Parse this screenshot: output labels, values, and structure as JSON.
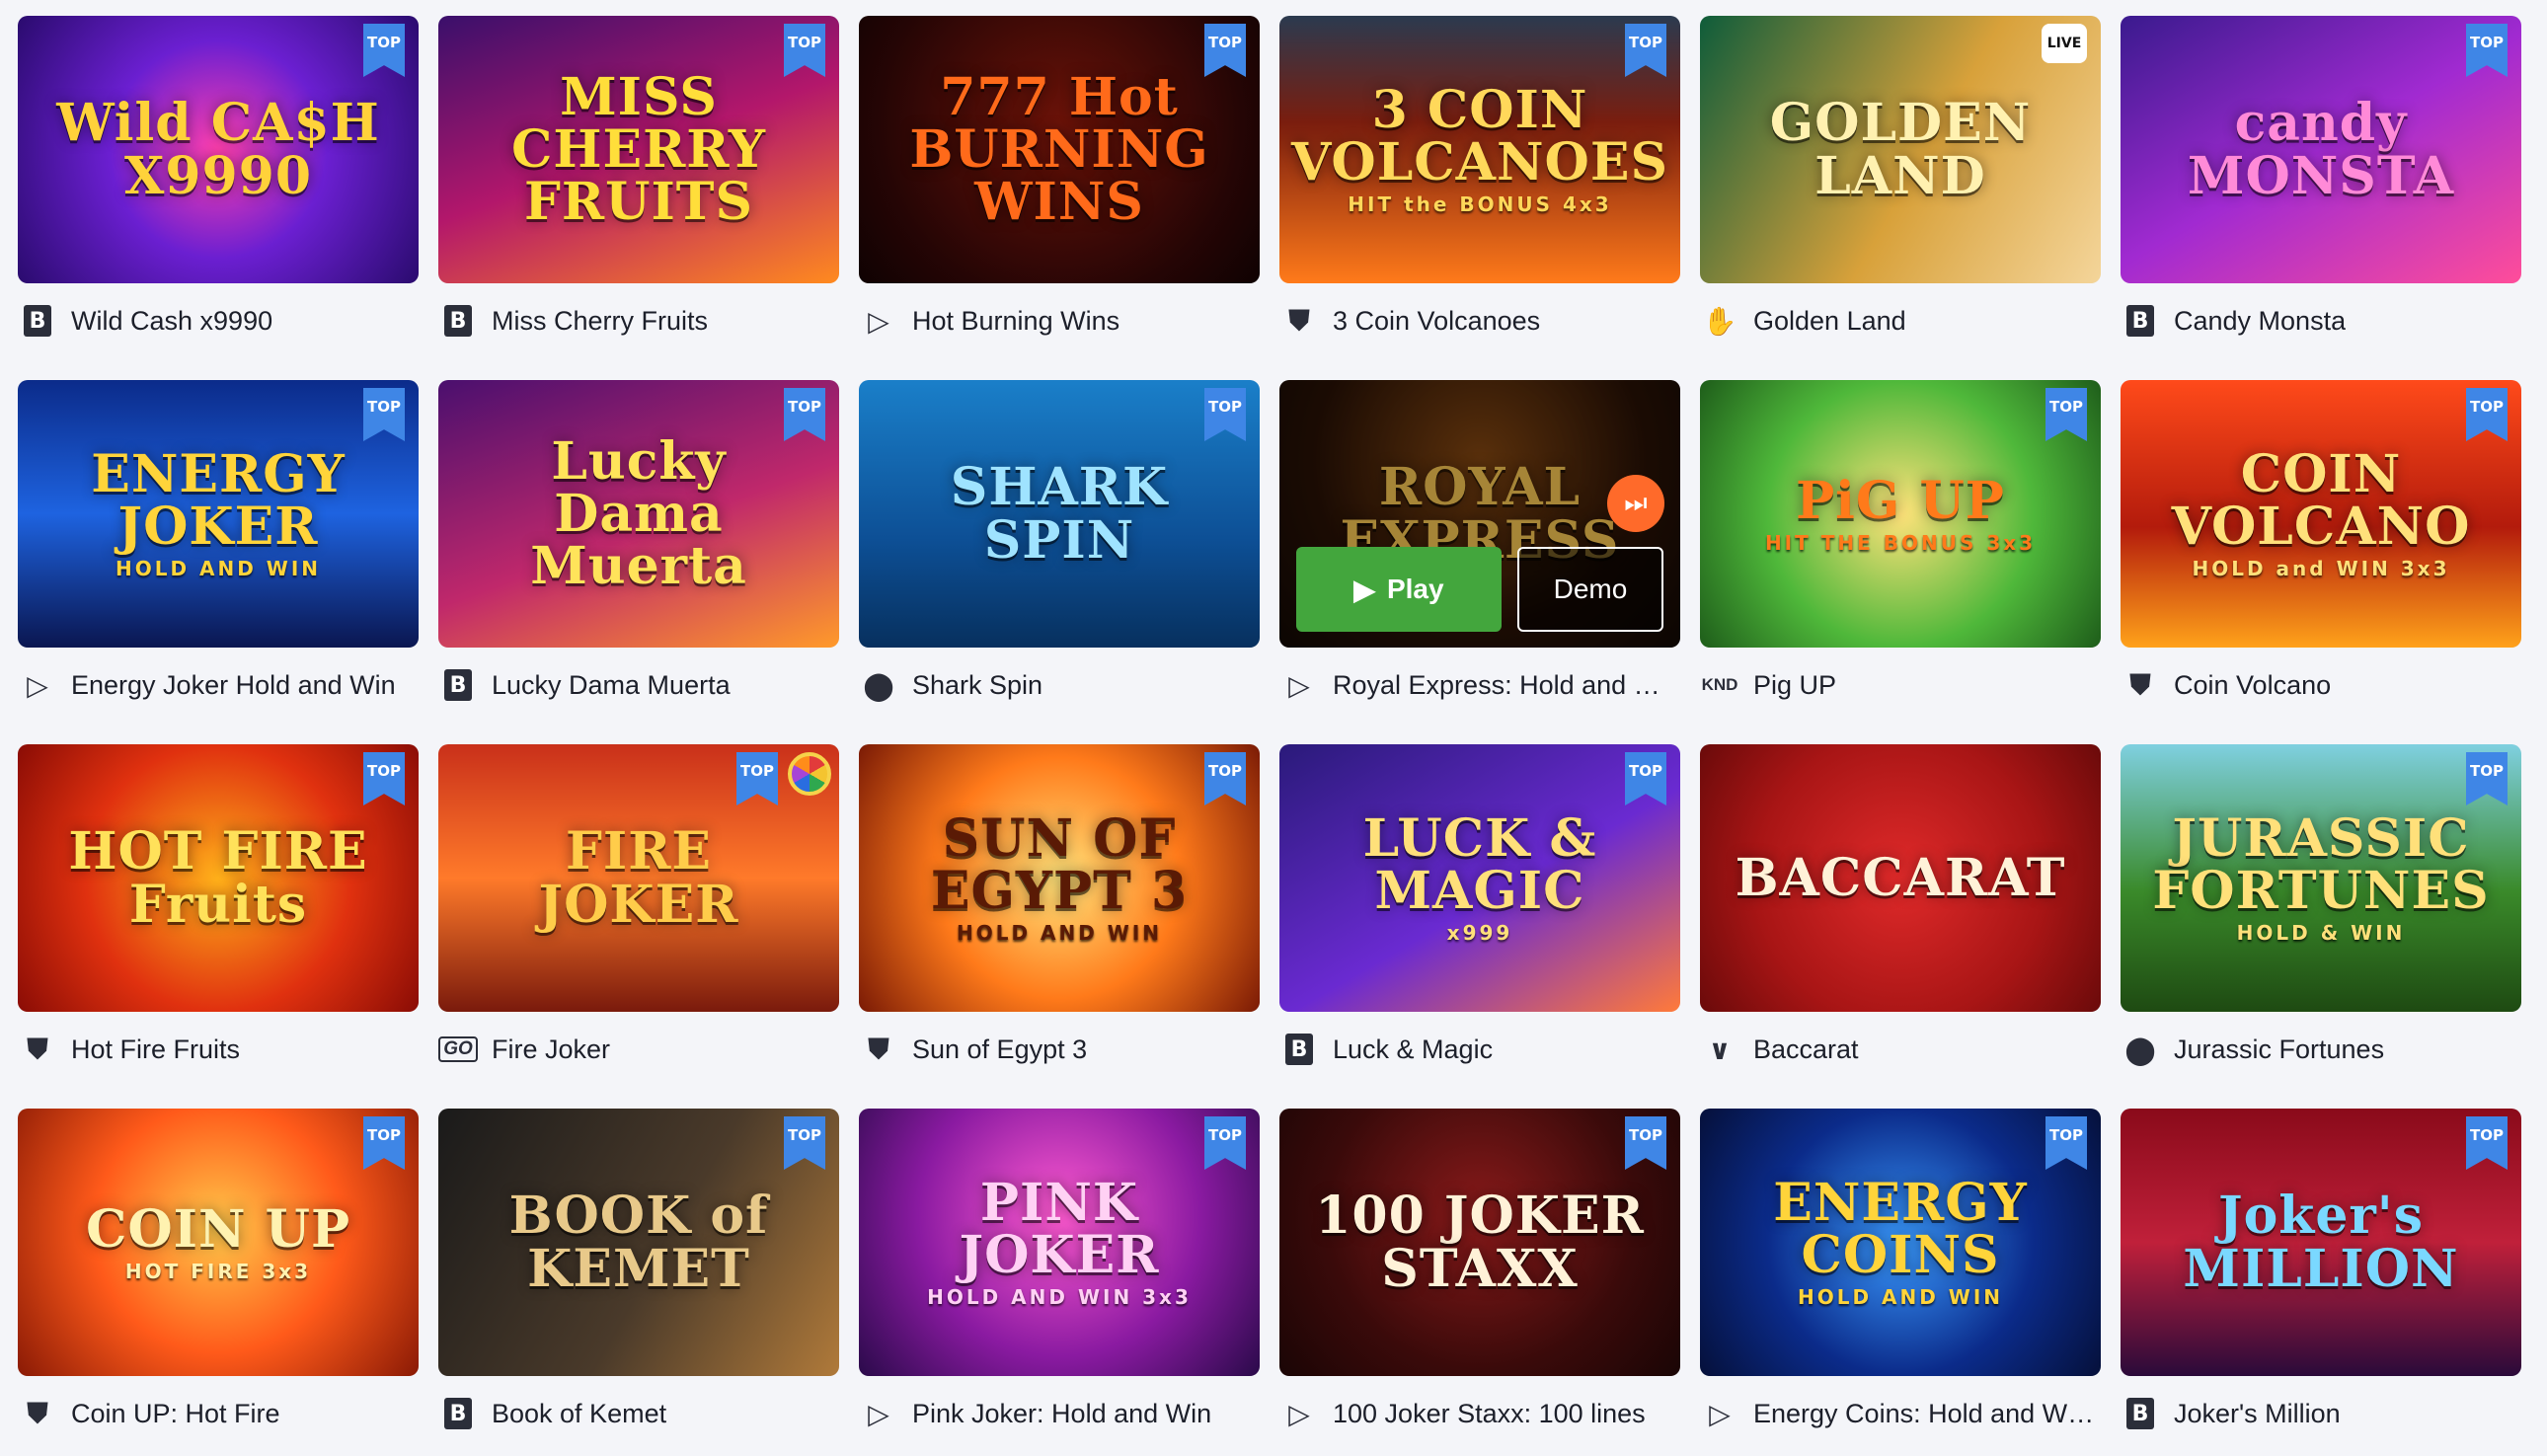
{
  "colors": {
    "background": "#f4f5f9",
    "top_badge": "#3f86e6",
    "play_button": "#43a63d",
    "title_text": "#1c1f2a"
  },
  "badges": {
    "top": "TOP",
    "live": "LIVE"
  },
  "hover": {
    "play_label": "Play",
    "demo_label": "Demo"
  },
  "games": [
    {
      "title": "Wild Cash x9990",
      "provider_icon": "b-letter-icon",
      "provider_glyph": "B",
      "badge": "top",
      "art_text": "Wild CA$H X9990",
      "art_sub": "",
      "bg": "radial-gradient(circle at 50% 50%, #ff3fae 0, #6b1fd1 45%, #2a0b6e 100%)",
      "text_color": "#ffd23a"
    },
    {
      "title": "Miss Cherry Fruits",
      "provider_icon": "b-letter-icon",
      "provider_glyph": "B",
      "badge": "top",
      "art_text": "MISS CHERRY FRUITS",
      "art_sub": "",
      "bg": "linear-gradient(160deg, #3a0f6b 0%, #b3176b 50%, #ff8a1f 100%)",
      "text_color": "#ffde3a"
    },
    {
      "title": "Hot Burning Wins",
      "provider_icon": "play-triangle-icon",
      "provider_glyph": "▷",
      "badge": "top",
      "art_text": "777 Hot BURNING WINS",
      "art_sub": "",
      "bg": "radial-gradient(circle at 50% 40%, #6a1208 0, #250505 70%, #0f0202 100%)",
      "text_color": "#ff6a1a"
    },
    {
      "title": "3 Coin Volcanoes",
      "provider_icon": "shield-icon",
      "provider_glyph": "⛊",
      "badge": "top",
      "art_text": "3 COIN VOLCANOES",
      "art_sub": "HIT the BONUS 4x3",
      "bg": "linear-gradient(180deg, #2b3a4f 0%, #7a1d0e 40%, #ff7a1a 100%)",
      "text_color": "#ffd85a"
    },
    {
      "title": "Golden Land",
      "provider_icon": "hand-icon",
      "provider_glyph": "✋",
      "badge": "live",
      "art_text": "GOLDEN LAND",
      "art_sub": "",
      "bg": "linear-gradient(120deg, #0e5c3a 0%, #d8a13a 55%, #f4d59a 100%)",
      "text_color": "#fff1b0"
    },
    {
      "title": "Candy Monsta",
      "provider_icon": "b-letter-icon",
      "provider_glyph": "B",
      "badge": "top",
      "art_text": "candy MONSTA",
      "art_sub": "",
      "bg": "linear-gradient(150deg, #3a1a8e 0%, #a12ad1 50%, #ff4d9a 100%)",
      "text_color": "#ff8ad8"
    },
    {
      "title": "Energy Joker Hold and Win",
      "provider_icon": "play-triangle-icon",
      "provider_glyph": "▷",
      "badge": "top",
      "art_text": "ENERGY JOKER",
      "art_sub": "HOLD AND WIN",
      "bg": "linear-gradient(180deg, #0b2b8a 0%, #1e63e0 50%, #0a1650 100%)",
      "text_color": "#ffd43a"
    },
    {
      "title": "Lucky Dama Muerta",
      "provider_icon": "b-letter-icon",
      "provider_glyph": "B",
      "badge": "top",
      "art_text": "Lucky Dama Muerta",
      "art_sub": "",
      "bg": "linear-gradient(160deg, #4a0f6e 0%, #c0286b 55%, #ff9a2a 100%)",
      "text_color": "#ffe35a"
    },
    {
      "title": "Shark Spin",
      "provider_icon": "location-pin-icon",
      "provider_glyph": "⬤",
      "badge": "top",
      "art_text": "SHARK SPIN",
      "art_sub": "",
      "bg": "linear-gradient(180deg, #1a7fc9 0%, #0d4f95 60%, #07305e 100%)",
      "text_color": "#9fe3ff"
    },
    {
      "title": "Royal Express: Hold and …",
      "provider_icon": "play-triangle-icon",
      "provider_glyph": "▷",
      "badge": "",
      "art_text": "ROYAL EXPRESS",
      "art_sub": "",
      "bg": "radial-gradient(circle at 50% 30%, #8a4a12 0, #2a1206 60%, #120904 100%)",
      "text_color": "#ffcc55",
      "hovered": true
    },
    {
      "title": "Pig UP",
      "provider_icon": "knd-text-icon",
      "provider_glyph": "KND",
      "badge": "top",
      "art_text": "PiG UP",
      "art_sub": "HIT THE BONUS 3x3",
      "bg": "radial-gradient(circle at 50% 50%, #ffe27a 0, #4fb83a 55%, #1e5d1a 100%)",
      "text_color": "#ff7a1a"
    },
    {
      "title": "Coin Volcano",
      "provider_icon": "shield-icon",
      "provider_glyph": "⛊",
      "badge": "top",
      "art_text": "COIN VOLCANO",
      "art_sub": "HOLD and WIN 3x3",
      "bg": "linear-gradient(180deg, #ff4a1a 0%, #b31b0c 55%, #ffa21a 100%)",
      "text_color": "#ffe07a"
    },
    {
      "title": "Hot Fire Fruits",
      "provider_icon": "shield-icon",
      "provider_glyph": "⛊",
      "badge": "top",
      "art_text": "HOT FIRE Fruits",
      "art_sub": "",
      "bg": "radial-gradient(circle at 50% 50%, #ffb01a 0, #e0310f 55%, #8a0c05 100%)",
      "text_color": "#ffe15a"
    },
    {
      "title": "Fire Joker",
      "provider_icon": "go-text-icon",
      "provider_glyph": "GO",
      "badge": "top",
      "wheel": true,
      "art_text": "FIRE JOKER",
      "art_sub": "",
      "bg": "linear-gradient(180deg, #c9301a 0%, #ff7a2a 50%, #7a1a0c 100%)",
      "text_color": "#ffcc4a"
    },
    {
      "title": "Sun of Egypt 3",
      "provider_icon": "shield-icon",
      "provider_glyph": "⛊",
      "badge": "top",
      "art_text": "SUN OF EGYPT 3",
      "art_sub": "HOLD AND WIN",
      "bg": "radial-gradient(circle at 50% 50%, #ffe27a 0, #ff7a1a 50%, #7a1a05 100%)",
      "text_color": "#5a1a05"
    },
    {
      "title": "Luck & Magic",
      "provider_icon": "b-letter-icon",
      "provider_glyph": "B",
      "badge": "top",
      "art_text": "LUCK & MAGIC",
      "art_sub": "x999",
      "bg": "linear-gradient(150deg, #2a1a7a 0%, #6a2ad1 55%, #ff7a3a 100%)",
      "text_color": "#ffe07a"
    },
    {
      "title": "Baccarat",
      "provider_icon": "v-check-icon",
      "provider_glyph": "∨",
      "badge": "",
      "art_text": "BACCARAT",
      "art_sub": "",
      "bg": "radial-gradient(circle at 50% 50%, #e02a2a 0, #a81515 60%, #6a0a0a 100%)",
      "text_color": "#fff2d8"
    },
    {
      "title": "Jurassic Fortunes",
      "provider_icon": "location-pin-icon",
      "provider_glyph": "⬤",
      "badge": "top",
      "art_text": "JURASSIC FORTUNES",
      "art_sub": "HOLD & WIN",
      "bg": "linear-gradient(180deg, #7fd0e0 0%, #3a8a2a 55%, #1e4a12 100%)",
      "text_color": "#ffe07a"
    },
    {
      "title": "Coin UP: Hot Fire",
      "provider_icon": "shield-icon",
      "provider_glyph": "⛊",
      "badge": "top",
      "art_text": "COIN UP",
      "art_sub": "HOT FIRE 3x3",
      "bg": "radial-gradient(circle at 50% 45%, #ffc84a 0, #ff5a1a 50%, #8a1a05 100%)",
      "text_color": "#fff2b0"
    },
    {
      "title": "Book of Kemet",
      "provider_icon": "b-letter-icon",
      "provider_glyph": "B",
      "badge": "top",
      "art_text": "BOOK of KEMET",
      "art_sub": "",
      "bg": "linear-gradient(120deg, #1a1a1a 0%, #4a3a2a 55%, #b07a3a 100%)",
      "text_color": "#e8c98a"
    },
    {
      "title": "Pink Joker: Hold and Win",
      "provider_icon": "play-triangle-icon",
      "provider_glyph": "▷",
      "badge": "top",
      "art_text": "PINK JOKER",
      "art_sub": "HOLD AND WIN 3x3",
      "bg": "radial-gradient(circle at 50% 40%, #ff5ad1 0, #8a1aa1 55%, #2a0a4a 100%)",
      "text_color": "#ffd1f4"
    },
    {
      "title": "100 Joker Staxx: 100 lines",
      "provider_icon": "play-triangle-icon",
      "provider_glyph": "▷",
      "badge": "top",
      "art_text": "100 JOKER STAXX",
      "art_sub": "",
      "bg": "radial-gradient(circle at 50% 40%, #8a1a1a 0, #3a0a0a 60%, #1a0505 100%)",
      "text_color": "#fff2d8"
    },
    {
      "title": "Energy Coins: Hold and W…",
      "provider_icon": "play-triangle-icon",
      "provider_glyph": "▷",
      "badge": "top",
      "art_text": "ENERGY COINS",
      "art_sub": "HOLD AND WIN",
      "bg": "radial-gradient(circle at 50% 50%, #3a9aff 0, #0b2b8a 55%, #05103a 100%)",
      "text_color": "#ffd43a"
    },
    {
      "title": "Joker's Million",
      "provider_icon": "b-letter-icon",
      "provider_glyph": "B",
      "badge": "top",
      "art_text": "Joker's MILLION",
      "art_sub": "",
      "bg": "linear-gradient(180deg, #8a0a1a 0%, #c0203a 50%, #2a0a3a 100%)",
      "text_color": "#7ad8ff"
    }
  ]
}
